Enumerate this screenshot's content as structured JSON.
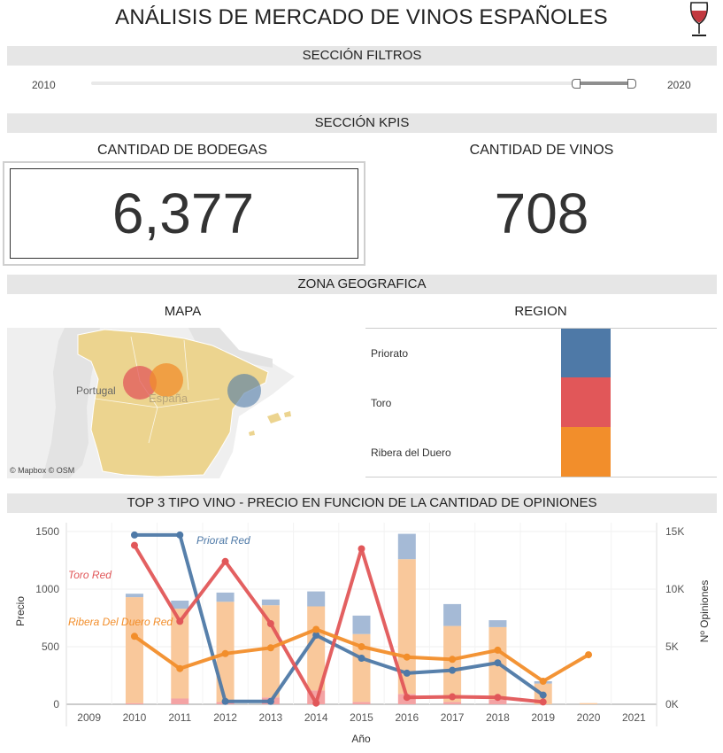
{
  "header": {
    "title": "ANÁLISIS DE MERCADO DE VINOS ESPAÑOLES",
    "icon": "wine-glass-icon"
  },
  "filters": {
    "section_title": "SECCIÓN FILTROS",
    "range_min_label": "2010",
    "range_max_label": "2020"
  },
  "kpis": {
    "section_title": "SECCIÓN KPIS",
    "wineries_label": "CANTIDAD DE BODEGAS",
    "wineries_value": "6,377",
    "wines_label": "CANTIDAD DE VINOS",
    "wines_value": "708"
  },
  "geo": {
    "section_title": "ZONA GEOGRAFICA",
    "map_title": "MAPA",
    "map_labels": {
      "portugal": "Portugal",
      "espana": "España"
    },
    "map_attribution": "© Mapbox © OSM",
    "region_title": "REGION",
    "regions": [
      {
        "name": "Priorato",
        "color": "#4e79a7"
      },
      {
        "name": "Toro",
        "color": "#e15759"
      },
      {
        "name": "Ribera del Duero",
        "color": "#f28e2b"
      }
    ]
  },
  "chart_section_title": "TOP 3 TIPO VINO - PRECIO EN FUNCION DE LA CANTIDAD DE OPINIONES",
  "chart_data": {
    "type": "line",
    "title": "TOP 3 TIPO VINO - PRECIO EN FUNCION DE LA CANTIDAD DE OPINIONES",
    "xlabel": "Año",
    "ylabel": "Precio",
    "y2label": "Nº Opiniones",
    "x": [
      2009,
      2010,
      2011,
      2012,
      2013,
      2014,
      2015,
      2016,
      2017,
      2018,
      2019,
      2020,
      2021
    ],
    "ylim": [
      0,
      1500
    ],
    "y_ticks": [
      "1500",
      "1000",
      "500",
      "0"
    ],
    "y2lim": [
      0,
      15000
    ],
    "y2_ticks": [
      "15K",
      "10K",
      "5K",
      "0K"
    ],
    "grid": true,
    "series": [
      {
        "name": "Priorat Red",
        "color": "#4e79a7",
        "x": [
          2010,
          2011,
          2012,
          2013,
          2014,
          2015,
          2016,
          2017,
          2018,
          2019
        ],
        "values": [
          1470,
          1470,
          25,
          25,
          600,
          400,
          270,
          295,
          360,
          80
        ]
      },
      {
        "name": "Toro Red",
        "color": "#e15759",
        "x": [
          2010,
          2011,
          2012,
          2013,
          2014,
          2015,
          2016,
          2017,
          2018,
          2019
        ],
        "values": [
          1380,
          720,
          1240,
          700,
          10,
          1350,
          60,
          65,
          60,
          20
        ]
      },
      {
        "name": "Ribera Del Duero Red",
        "color": "#f28e2b",
        "x": [
          2010,
          2011,
          2012,
          2013,
          2014,
          2015,
          2016,
          2017,
          2018,
          2019,
          2020
        ],
        "values": [
          590,
          310,
          440,
          490,
          650,
          500,
          410,
          390,
          470,
          200,
          430
        ]
      }
    ],
    "bars": {
      "axis": "secondary",
      "stacks": [
        {
          "x": 2010,
          "ribera": 9200,
          "toro": 100,
          "priorat": 300
        },
        {
          "x": 2011,
          "ribera": 7800,
          "toro": 500,
          "priorat": 700
        },
        {
          "x": 2012,
          "ribera": 8700,
          "toro": 200,
          "priorat": 800
        },
        {
          "x": 2013,
          "ribera": 8000,
          "toro": 600,
          "priorat": 500
        },
        {
          "x": 2014,
          "ribera": 7300,
          "toro": 1200,
          "priorat": 1300
        },
        {
          "x": 2015,
          "ribera": 5900,
          "toro": 200,
          "priorat": 1600
        },
        {
          "x": 2016,
          "ribera": 11700,
          "toro": 900,
          "priorat": 2200
        },
        {
          "x": 2017,
          "ribera": 6600,
          "toro": 200,
          "priorat": 1900
        },
        {
          "x": 2018,
          "ribera": 6300,
          "toro": 400,
          "priorat": 600
        },
        {
          "x": 2019,
          "ribera": 1800,
          "toro": 0,
          "priorat": 200
        },
        {
          "x": 2020,
          "ribera": 100,
          "toro": 0,
          "priorat": 0
        }
      ],
      "colors": {
        "ribera": "#f9c89b",
        "toro": "#f4a3a4",
        "priorat": "#a5bad6"
      }
    }
  }
}
